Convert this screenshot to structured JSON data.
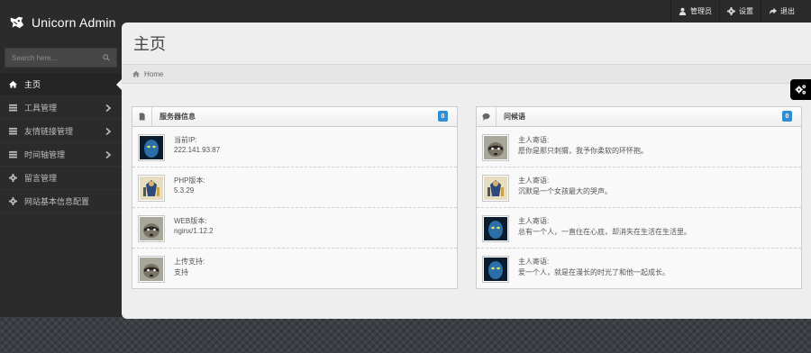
{
  "header": {
    "brand": "Unicorn Admin"
  },
  "topnav": {
    "items": [
      {
        "label": "管理员",
        "icon": "user-icon"
      },
      {
        "label": "设置",
        "icon": "gear-icon"
      },
      {
        "label": "退出",
        "icon": "share-icon"
      }
    ]
  },
  "sidebar": {
    "search_placeholder": "Search here...",
    "items": [
      {
        "label": "主页",
        "icon": "home-icon",
        "active": true,
        "has_submenu": false
      },
      {
        "label": "工具管理",
        "icon": "list-icon",
        "active": false,
        "has_submenu": true
      },
      {
        "label": "友情链接管理",
        "icon": "list-icon",
        "active": false,
        "has_submenu": true
      },
      {
        "label": "时间轴管理",
        "icon": "list-icon",
        "active": false,
        "has_submenu": true
      },
      {
        "label": "留言管理",
        "icon": "gear-icon",
        "active": false,
        "has_submenu": false
      },
      {
        "label": "网站基本信息配置",
        "icon": "gear-icon",
        "active": false,
        "has_submenu": false
      }
    ]
  },
  "main": {
    "page_title": "主页",
    "breadcrumb": {
      "label": "Home",
      "icon": "home-icon"
    },
    "server_panel": {
      "title": "服务器信息",
      "badge": "0",
      "rows": [
        {
          "label": "当前IP:",
          "value": "222.141.93.87",
          "avatar": "blue-face-avatar"
        },
        {
          "label": "PHP版本:",
          "value": "5.3.29",
          "avatar": "armored-figure-avatar"
        },
        {
          "label": "WEB版本:",
          "value": "nginx/1.12.2",
          "avatar": "raccoon-avatar"
        },
        {
          "label": "上传支持:",
          "value": "支持",
          "avatar": "raccoon-avatar"
        }
      ]
    },
    "greeting_panel": {
      "title": "问候语",
      "badge": "0",
      "rows": [
        {
          "label": "主人寄语:",
          "value": "愿你是那只刺猬，我予你柔软的环怀抱。",
          "avatar": "raccoon-avatar"
        },
        {
          "label": "主人寄语:",
          "value": "沉默是一个女孩最大的哭声。",
          "avatar": "armored-figure-avatar"
        },
        {
          "label": "主人寄语:",
          "value": "总有一个人，一直住在心底，却消失在生活在生活里。",
          "avatar": "blue-face-avatar"
        },
        {
          "label": "主人寄语:",
          "value": "爱一个人，就是在漫长的时光了和他一起成长。",
          "avatar": "blue-face-avatar"
        }
      ]
    }
  },
  "colors": {
    "accent_badge": "#2f8fd4",
    "sidebar_bg": "#2b2b2b",
    "content_bg": "#eeeeee"
  }
}
